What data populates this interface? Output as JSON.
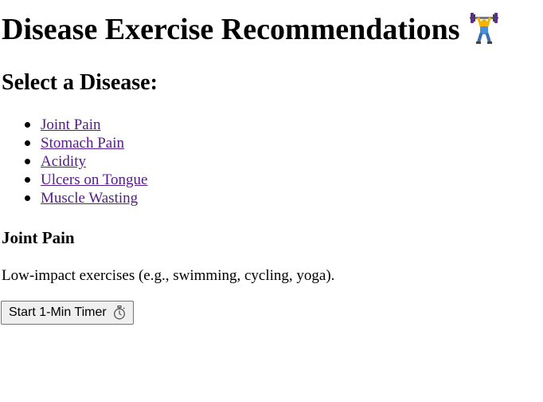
{
  "page": {
    "title": "Disease Exercise Recommendations",
    "title_icon": "weightlifter-icon",
    "select_heading": "Select a Disease:"
  },
  "diseases": [
    {
      "label": "Joint Pain"
    },
    {
      "label": "Stomach Pain"
    },
    {
      "label": "Acidity"
    },
    {
      "label": "Ulcers on Tongue"
    },
    {
      "label": "Muscle Wasting"
    }
  ],
  "selected": {
    "name": "Joint Pain",
    "recommendation": "Low-impact exercises (e.g., swimming, cycling, yoga)."
  },
  "timer": {
    "button_label": "Start 1-Min Timer",
    "icon": "stopwatch-icon"
  },
  "colors": {
    "link": "#551a8b",
    "button_bg": "#efefef",
    "button_border": "#767676"
  }
}
